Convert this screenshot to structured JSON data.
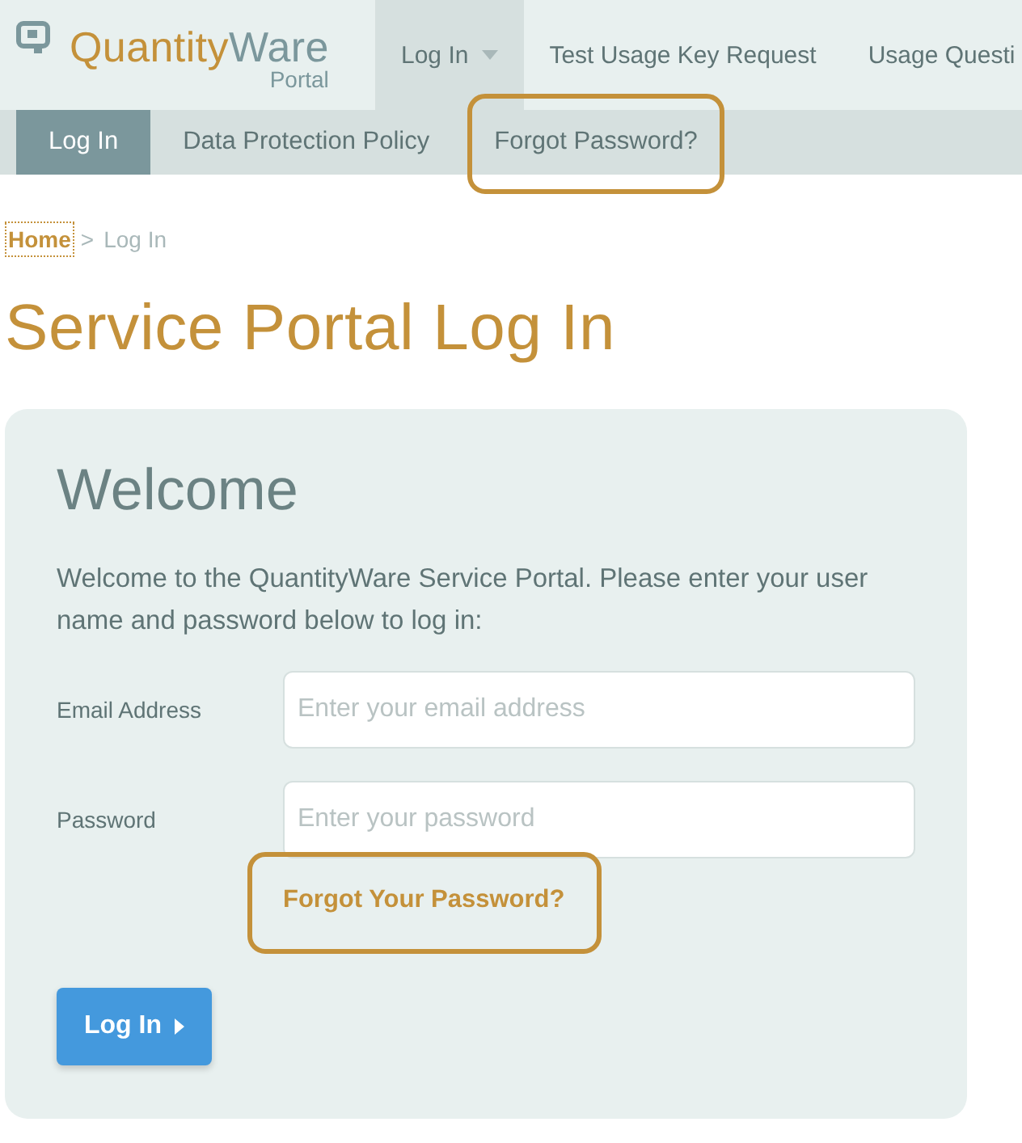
{
  "header": {
    "logo": {
      "brand_first": "Quantity",
      "brand_second": "Ware",
      "subtitle": "Portal"
    },
    "main_nav": [
      {
        "label": "Log In",
        "selected": true,
        "has_dropdown": true
      },
      {
        "label": "Test Usage Key Request",
        "selected": false,
        "has_dropdown": false
      },
      {
        "label": "Usage Questi",
        "selected": false,
        "has_dropdown": false
      }
    ]
  },
  "sub_nav": [
    {
      "label": "Log In",
      "selected": true,
      "highlighted": false
    },
    {
      "label": "Data Protection Policy",
      "selected": false,
      "highlighted": false
    },
    {
      "label": "Forgot Password?",
      "selected": false,
      "highlighted": true
    }
  ],
  "breadcrumb": {
    "items": [
      {
        "label": "Home",
        "link": true,
        "focused": true
      },
      {
        "label": "Log In",
        "link": false,
        "focused": false
      }
    ],
    "separator": ">"
  },
  "page_title": "Service Portal Log In",
  "login_card": {
    "title": "Welcome",
    "intro": "Welcome to the QuantityWare Service Portal. Please enter your user name and password below to log in:",
    "fields": [
      {
        "label": "Email Address",
        "placeholder": "Enter your email address"
      },
      {
        "label": "Password",
        "placeholder": "Enter your password"
      }
    ],
    "forgot_link": {
      "label": "Forgot Your Password?",
      "highlighted": true
    },
    "submit_button": {
      "label": "Log In"
    }
  }
}
